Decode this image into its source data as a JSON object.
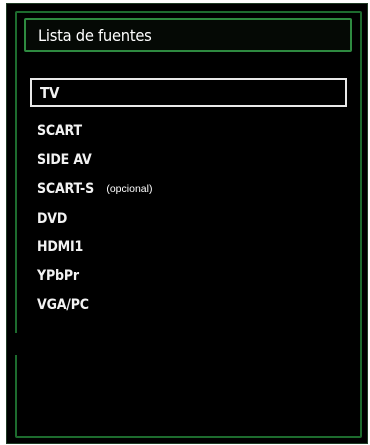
{
  "panel": {
    "title": "Lista de fuentes"
  },
  "sources": [
    {
      "label": "TV",
      "selected": true,
      "note": ""
    },
    {
      "label": "SCART",
      "selected": false,
      "note": ""
    },
    {
      "label": "SIDE AV",
      "selected": false,
      "note": ""
    },
    {
      "label": "SCART-S",
      "selected": false,
      "note": "(opcional)"
    },
    {
      "label": "DVD",
      "selected": false,
      "note": ""
    },
    {
      "label": "HDMI1",
      "selected": false,
      "note": ""
    },
    {
      "label": "YPbPr",
      "selected": false,
      "note": ""
    },
    {
      "label": "VGA/PC",
      "selected": false,
      "note": ""
    }
  ],
  "colors": {
    "background": "#000000",
    "frame_green": "#1d6b2e",
    "title_border_green": "#2e8a40",
    "text": "#f2f2f2",
    "selection_border": "#e8e8e8"
  }
}
